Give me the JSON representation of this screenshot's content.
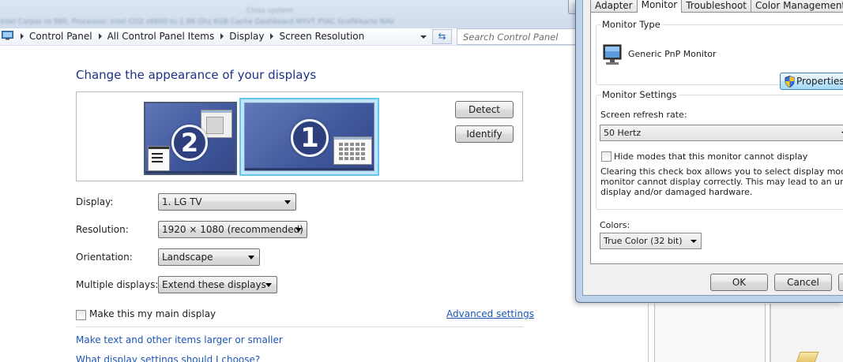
{
  "background_title_text": "Closs system",
  "background_strip_text": "Intel Corpor ro 980, Processor: Intel CO2 s6600 to 1.86 Ghz 6GB Cache Dashboard MYVT PYAC Grafikkarte NAV",
  "addressbar": {
    "breadcrumbs": [
      "Control Panel",
      "All Control Panel Items",
      "Display",
      "Screen Resolution"
    ],
    "refresh_glyph": "⇆",
    "search_placeholder": "Search Control Panel"
  },
  "main": {
    "title": "Change the appearance of your displays",
    "monitor_labels": [
      "2",
      "1"
    ],
    "detect_label": "Detect",
    "identify_label": "Identify",
    "display_label": "Display:",
    "display_value": "1. LG TV",
    "resolution_label": "Resolution:",
    "resolution_value": "1920 × 1080 (recommended)",
    "orientation_label": "Orientation:",
    "orientation_value": "Landscape",
    "multiple_label": "Multiple displays:",
    "multiple_value": "Extend these displays",
    "main_display_label": "Make this my main display",
    "main_display_checked": false,
    "advanced_link": "Advanced settings",
    "link_larger": "Make text and other items larger or smaller",
    "link_which": "What display settings should I choose?"
  },
  "dialog": {
    "tabs": [
      {
        "label": "Adapter",
        "active": false
      },
      {
        "label": "Monitor",
        "active": true
      },
      {
        "label": "Troubleshoot",
        "active": false
      },
      {
        "label": "Color Management",
        "active": false
      }
    ],
    "monitor_type_title": "Monitor Type",
    "monitor_name": "Generic PnP Monitor",
    "properties_label": "Properties",
    "monitor_settings_title": "Monitor Settings",
    "refresh_rate_label": "Screen refresh rate:",
    "refresh_rate_value": "50 Hertz",
    "hide_modes_label": "Hide modes that this monitor cannot display",
    "hide_modes_checked": false,
    "hide_modes_help": [
      "Clearing this check box allows you to select display modes that",
      "monitor cannot display correctly. This may lead to an unusable",
      "display and/or damaged hardware."
    ],
    "colors_label": "Colors:",
    "colors_value": "True Color (32 bit)",
    "ok_label": "OK",
    "cancel_label": "Cancel"
  },
  "colors": {
    "title_blue": "#1e3287",
    "link_blue": "#1b56b5",
    "selected_monitor_border": "#64c6f1",
    "dialog_frame": "#bcd1ea"
  }
}
